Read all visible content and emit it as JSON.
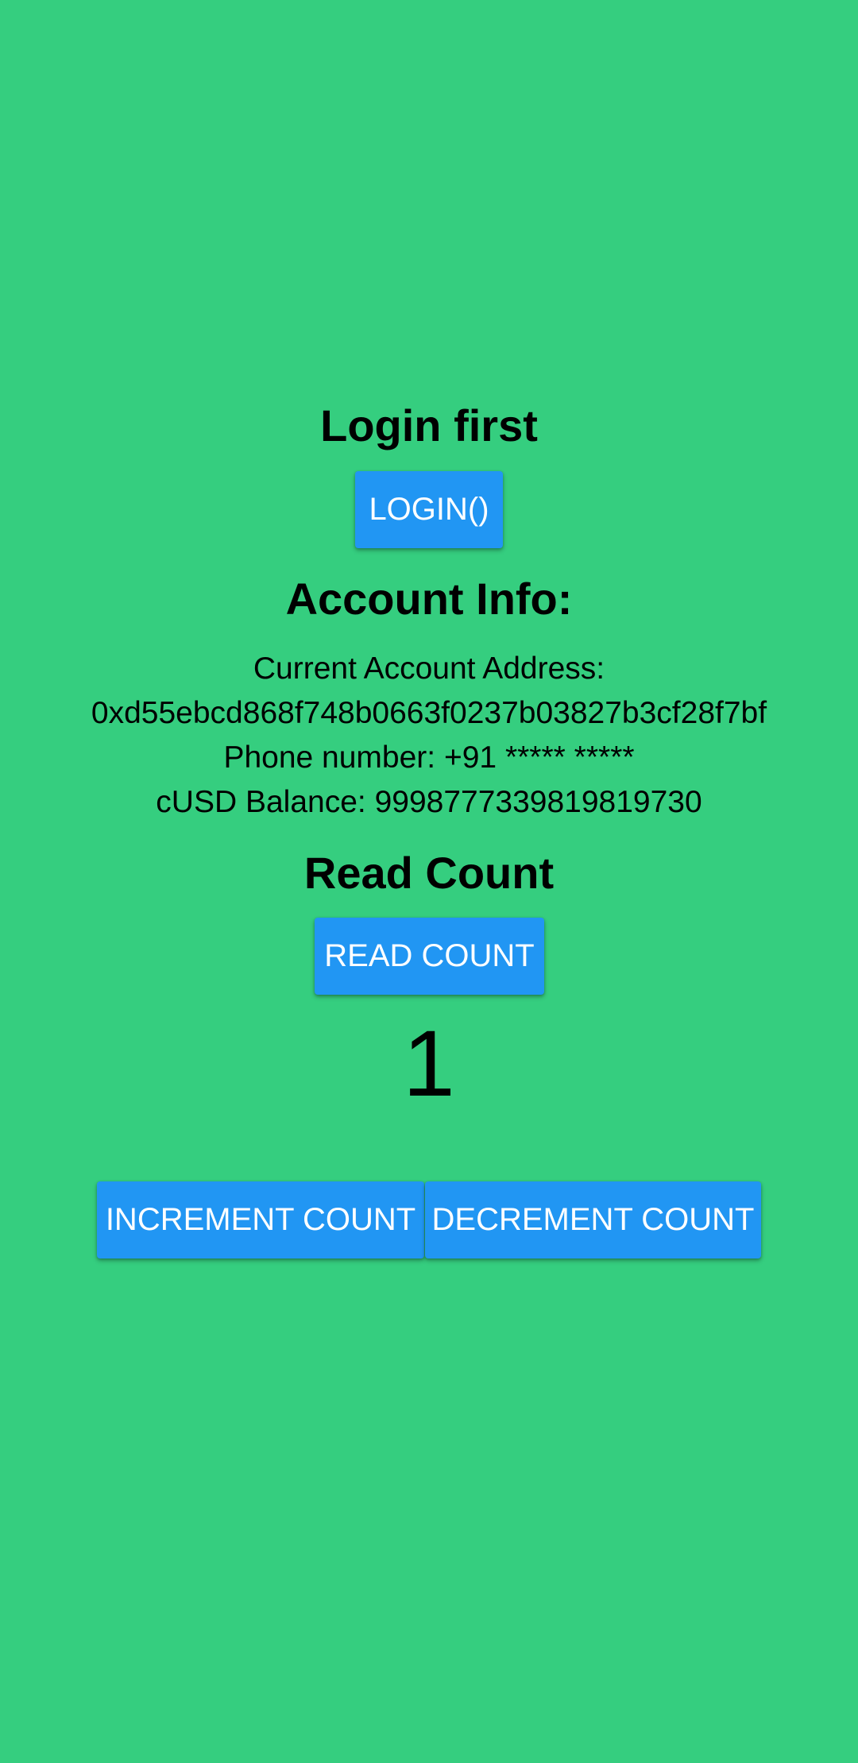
{
  "colors": {
    "background": "#35CE7F",
    "button": "#2196F3",
    "button_text": "#FFFFFF",
    "text": "#000000"
  },
  "login": {
    "heading": "Login first",
    "button_label": "LOGIN()"
  },
  "account": {
    "heading": "Account Info:",
    "address_label": "Current Account Address:",
    "address": "0xd55ebcd868f748b0663f0237b03827b3cf28f7bf",
    "phone": "Phone number: +91 ***** *****",
    "balance": "cUSD Balance: 9998777339819819730"
  },
  "counter": {
    "heading": "Read Count",
    "read_button_label": "READ COUNT",
    "value": "1",
    "increment_label": "INCREMENT COUNT",
    "decrement_label": "DECREMENT COUNT"
  }
}
